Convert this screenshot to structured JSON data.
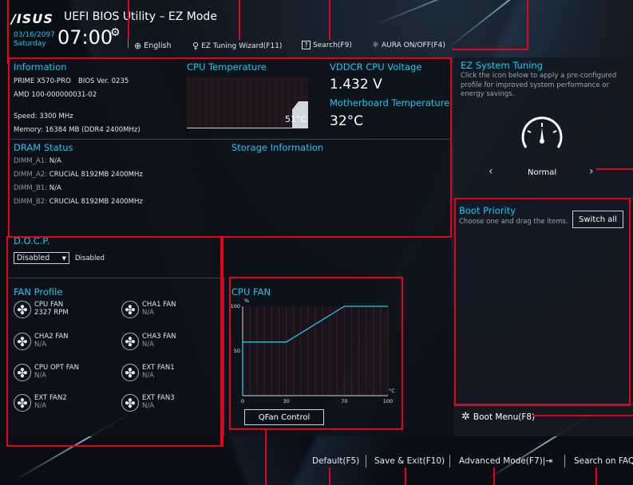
{
  "header": {
    "brand": "/ISUS",
    "title": "UEFI BIOS Utility – EZ Mode",
    "date": "03/16/2097",
    "day": "Saturday",
    "time": "07:00",
    "language": "English",
    "ez_tuning_wizard": "EZ Tuning Wizard(F11)",
    "search": "Search(F9)",
    "aura": "AURA ON/OFF(F4)"
  },
  "information": {
    "title": "Information",
    "board": "PRIME X570-PRO",
    "bios": "BIOS Ver. 0235",
    "cpu": "AMD 100-000000031-02",
    "speed": "Speed: 3300 MHz",
    "memory": "Memory: 16384 MB (DDR4 2400MHz)"
  },
  "cpu_temp": {
    "title": "CPU Temperature",
    "value": "51°C"
  },
  "vddcr": {
    "title": "VDDCR CPU Voltage",
    "value": "1.432 V"
  },
  "mb_temp": {
    "title": "Motherboard Temperature",
    "value": "32°C"
  },
  "dram": {
    "title": "DRAM Status",
    "slots": [
      {
        "name": "DIMM_A1:",
        "value": "N/A"
      },
      {
        "name": "DIMM_A2:",
        "value": "CRUCIAL 8192MB 2400MHz"
      },
      {
        "name": "DIMM_B1:",
        "value": "N/A"
      },
      {
        "name": "DIMM_B2:",
        "value": "CRUCIAL 8192MB 2400MHz"
      }
    ]
  },
  "storage": {
    "title": "Storage Information"
  },
  "docp": {
    "title": "D.O.C.P.",
    "selected": "Disabled",
    "status": "Disabled"
  },
  "fan_profile": {
    "title": "FAN Profile",
    "fans": [
      {
        "name": "CPU FAN",
        "value": "2327 RPM"
      },
      {
        "name": "CHA1 FAN",
        "value": "N/A"
      },
      {
        "name": "CHA2 FAN",
        "value": "N/A"
      },
      {
        "name": "CHA3 FAN",
        "value": "N/A"
      },
      {
        "name": "CPU OPT FAN",
        "value": "N/A"
      },
      {
        "name": "EXT FAN1",
        "value": "N/A"
      },
      {
        "name": "EXT FAN2",
        "value": "N/A"
      },
      {
        "name": "EXT FAN3",
        "value": "N/A"
      }
    ]
  },
  "cpu_fan": {
    "title": "CPU FAN",
    "y_unit": "%",
    "x_unit": "°C",
    "qfan_button": "QFan Control"
  },
  "chart_data": {
    "type": "line",
    "title": "CPU FAN",
    "xlabel": "°C",
    "ylabel": "%",
    "xlim": [
      0,
      100
    ],
    "ylim": [
      0,
      100
    ],
    "x_ticks": [
      "0",
      "30",
      "70",
      "100"
    ],
    "y_ticks": [
      "100",
      "50"
    ],
    "series": [
      {
        "x": [
          0,
          0,
          30,
          70,
          100
        ],
        "y": [
          0,
          60,
          60,
          100,
          100
        ]
      }
    ]
  },
  "ez_tuning": {
    "title": "EZ System Tuning",
    "description": "Click the icon below to apply a pre-configured profile for improved system performance or energy savings.",
    "mode": "Normal",
    "prev": "‹",
    "next": "›"
  },
  "boot_priority": {
    "title": "Boot Priority",
    "description": "Choose one and drag the items.",
    "switch_all": "Switch all"
  },
  "boot_menu": "Boot Menu(F8)",
  "footer": {
    "default": "Default(F5)",
    "save_exit": "Save & Exit(F10)",
    "advanced": "Advanced Mode(F7)|⇥",
    "search_faq": "Search on FAQ"
  },
  "colors": {
    "accent": "#1ec8f0",
    "highlight": "#e8001c"
  }
}
